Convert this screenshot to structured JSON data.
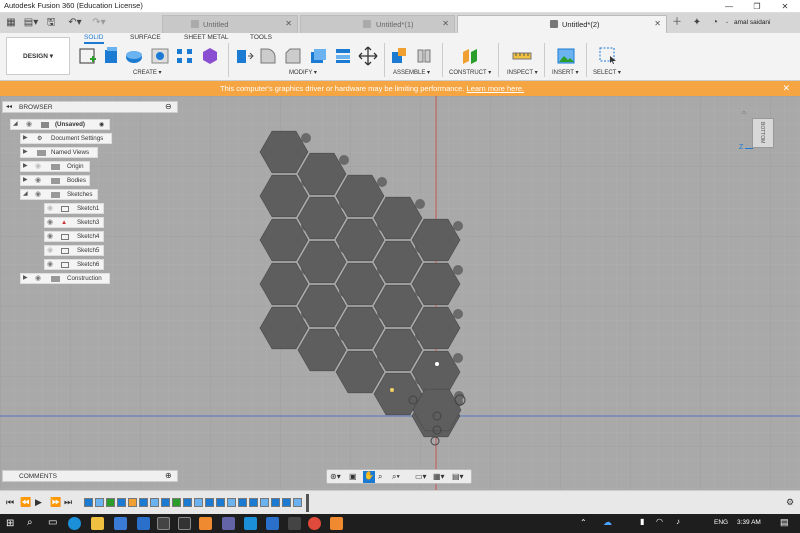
{
  "window": {
    "title": "Autodesk Fusion 360 (Education License)",
    "controls": [
      "—",
      "❐",
      "✕"
    ]
  },
  "tabs": [
    {
      "label": "Untitled"
    },
    {
      "label": "Untitled*(1)"
    },
    {
      "label": "Untitled*(2)"
    }
  ],
  "user": {
    "name": "amal saidani"
  },
  "toolbar": {
    "workspace": "DESIGN ▾",
    "workspace_tabs": [
      "SOLID",
      "SURFACE",
      "SHEET METAL",
      "TOOLS"
    ],
    "groups": [
      "CREATE ▾",
      "MODIFY ▾",
      "ASSEMBLE ▾",
      "CONSTRUCT ▾",
      "INSPECT ▾",
      "INSERT ▾",
      "SELECT ▾"
    ]
  },
  "warning": {
    "message": "This computer's graphics driver or hardware may be limiting performance.",
    "link": "Learn more here."
  },
  "browser": {
    "title": "BROWSER",
    "root": "(Unsaved)",
    "nodes": [
      "Document Settings",
      "Named Views",
      "Origin",
      "Bodies",
      "Sketches"
    ],
    "sketches": [
      "Sketch1",
      "Sketch3",
      "Sketch4",
      "Sketch5",
      "Sketch6"
    ],
    "construction": "Construction"
  },
  "comments": {
    "label": "COMMENTS"
  },
  "viewcube": {
    "label": "BOTTOM",
    "axis": "Z"
  },
  "taskbar": {
    "lang": "ENG",
    "time": "3:39 AM"
  },
  "colors": {
    "accent": "#1b7ad1",
    "warning": "#f5a541",
    "viewport": "#a9a9a9",
    "model": "#5e5e5e",
    "taskbar": "#1e1e1e"
  }
}
